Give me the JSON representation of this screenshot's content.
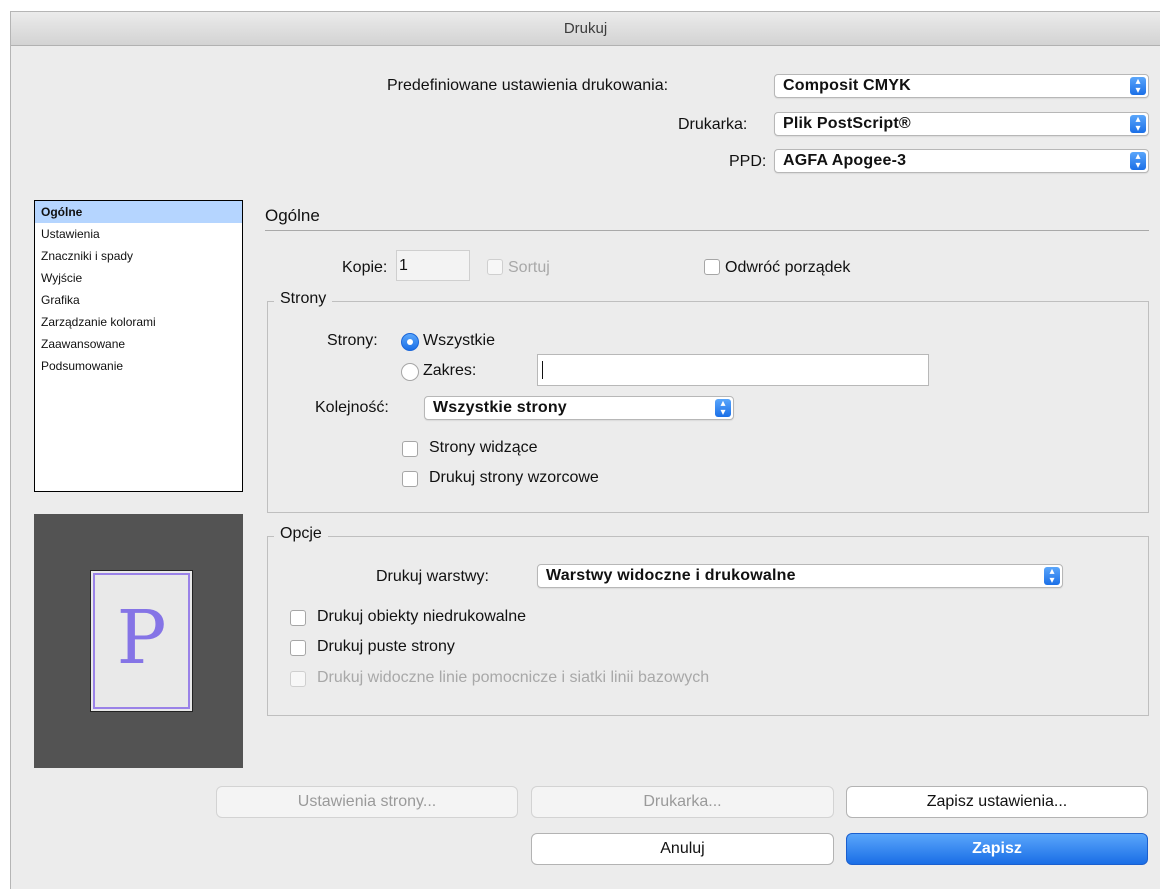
{
  "window": {
    "title": "Drukuj"
  },
  "top": {
    "preset_label": "Predefiniowane ustawienia drukowania:",
    "preset_value": "Composit CMYK",
    "printer_label": "Drukarka:",
    "printer_value": "Plik PostScript®",
    "ppd_label": "PPD:",
    "ppd_value": "AGFA Apogee-3"
  },
  "sidebar": {
    "items": [
      {
        "label": "Ogólne"
      },
      {
        "label": "Ustawienia"
      },
      {
        "label": "Znaczniki i spady"
      },
      {
        "label": "Wyjście"
      },
      {
        "label": "Grafika"
      },
      {
        "label": "Zarządzanie kolorami"
      },
      {
        "label": "Zaawansowane"
      },
      {
        "label": "Podsumowanie"
      }
    ]
  },
  "preview": {
    "letter": "P"
  },
  "general": {
    "title": "Ogólne",
    "copies_label": "Kopie:",
    "copies_value": "1",
    "collate_label": "Sortuj",
    "reverse_label": "Odwróć porządek"
  },
  "pages": {
    "group_title": "Strony",
    "pages_label": "Strony:",
    "all_label": "Wszystkie",
    "range_label": "Zakres:",
    "range_value": "",
    "order_label": "Kolejność:",
    "order_value": "Wszystkie strony",
    "spreads_label": "Strony widzące",
    "master_label": "Drukuj strony wzorcowe"
  },
  "options": {
    "group_title": "Opcje",
    "layers_label": "Drukuj warstwy:",
    "layers_value": "Warstwy widoczne i drukowalne",
    "nonprint_label": "Drukuj obiekty niedrukowalne",
    "blank_label": "Drukuj puste strony",
    "guides_label": "Drukuj widoczne linie pomocnicze i siatki linii bazowych"
  },
  "buttons": {
    "page_setup": "Ustawienia strony...",
    "printer": "Drukarka...",
    "save_preset": "Zapisz ustawienia...",
    "cancel": "Anuluj",
    "save": "Zapisz"
  }
}
